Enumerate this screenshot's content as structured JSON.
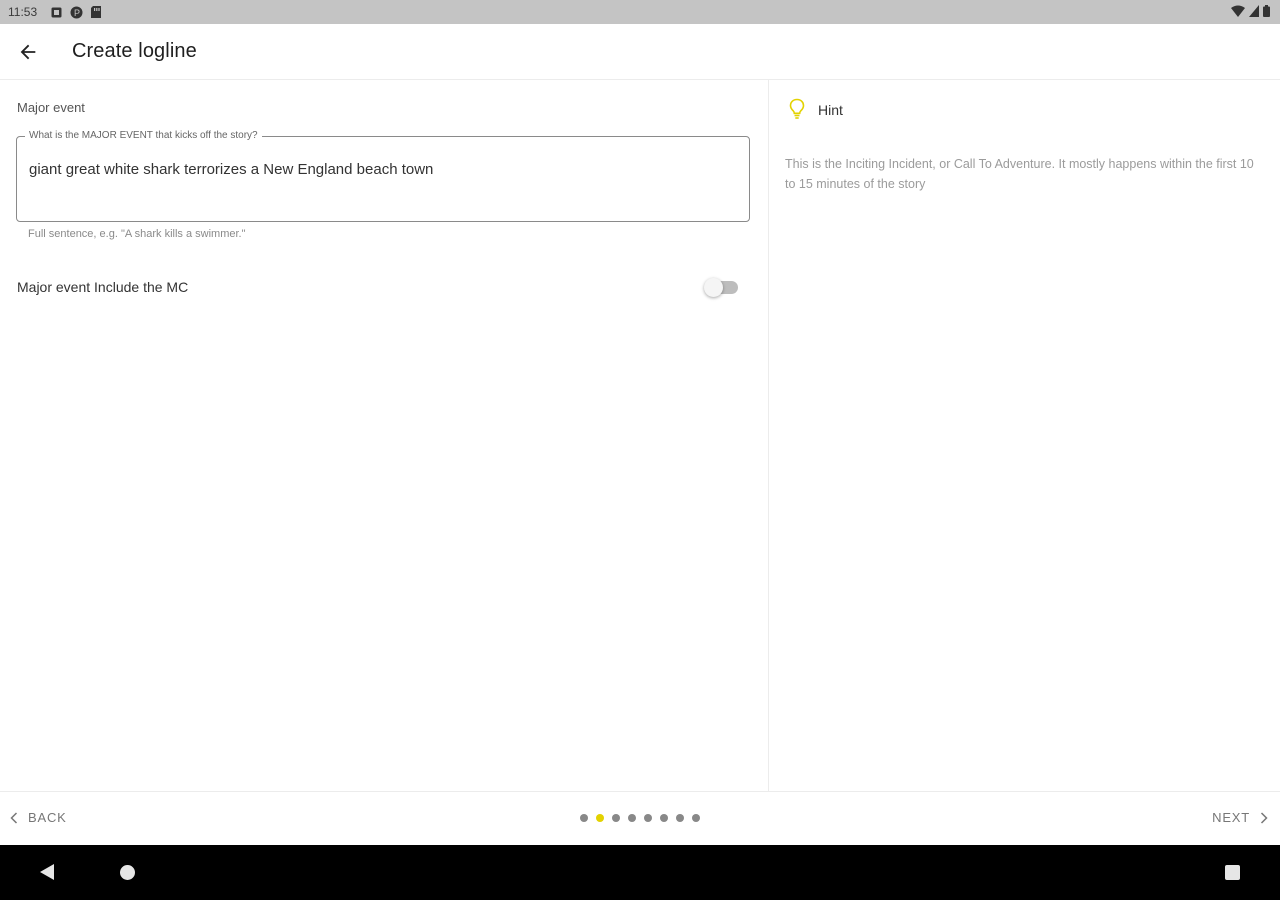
{
  "status_bar": {
    "time": "11:53",
    "notification_icons": [
      "square-notification-icon",
      "p-circle-icon",
      "sd-card-icon"
    ],
    "system_icons": [
      "wifi-icon",
      "signal-icon",
      "battery-icon"
    ]
  },
  "app_bar": {
    "title": "Create logline",
    "back_icon": "arrow-left-icon"
  },
  "form": {
    "section_label": "Major event",
    "field_label": "What is the MAJOR EVENT that kicks off the story?",
    "field_value": "giant great white shark terrorizes a New England beach town",
    "helper_text": "Full sentence, e.g. \"A shark kills a swimmer.\"",
    "toggle_label": "Major event Include the MC",
    "toggle_on": false
  },
  "hint": {
    "title": "Hint",
    "icon": "lightbulb-icon",
    "body": "This is the Inciting Incident, or Call To Adventure. It mostly happens within the first 10 to 15 minutes of the story"
  },
  "pager": {
    "back_label": "BACK",
    "next_label": "NEXT",
    "total_steps": 8,
    "current_step": 2
  },
  "colors": {
    "accent": "#e3d200",
    "status_bar_bg": "#c4c4c4",
    "system_nav_bg": "#000000"
  }
}
